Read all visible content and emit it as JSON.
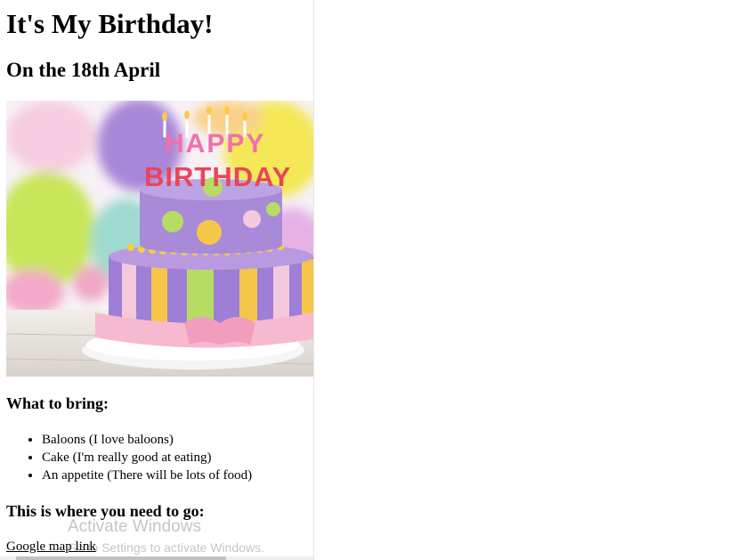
{
  "page": {
    "title": "It's My Birthday!",
    "date_line": "On the 18th April"
  },
  "image": {
    "cake_text_line1": "HAPPY",
    "cake_text_line2": "BIRTHDAY"
  },
  "bring": {
    "heading": "What to bring:",
    "items": [
      "Baloons (I love baloons)",
      "Cake (I'm really good at eating)",
      "An appetite (There will be lots of food)"
    ]
  },
  "directions": {
    "heading": "This is where you need to go:",
    "link_text": "Google map link"
  },
  "watermark": {
    "line1": "Activate Windows",
    "line2": "Go to Settings to activate Windows."
  }
}
